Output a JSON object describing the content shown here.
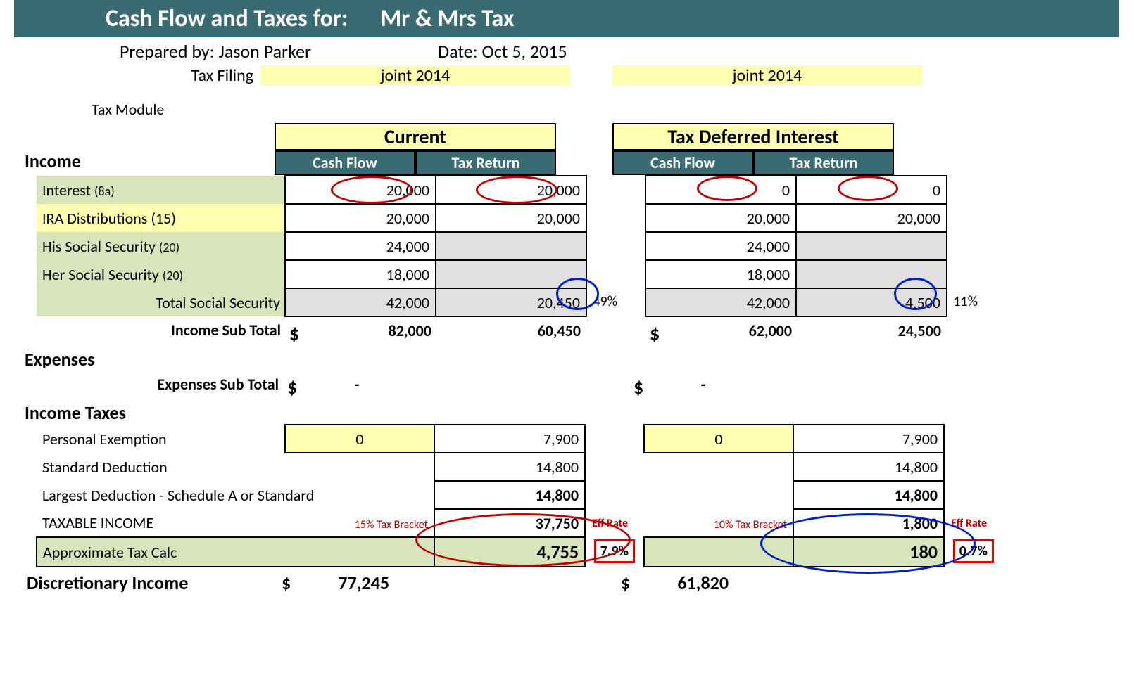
{
  "header": {
    "title_prefix": "Cash Flow and Taxes for:",
    "client_name": "Mr & Mrs Tax",
    "prepared_by_label": "Prepared by:",
    "prepared_by": "Jason Parker",
    "date_label": "Date:",
    "date": "Oct 5, 2015",
    "tax_filing_label": "Tax Filing",
    "filing_left": "joint 2014",
    "filing_right": "joint 2014",
    "module_label": "Tax Module"
  },
  "sections": {
    "income": "Income",
    "expenses": "Expenses",
    "income_taxes": "Income Taxes",
    "discretionary": "Discretionary Income"
  },
  "colheaders": {
    "current": "Current",
    "deferred": "Tax Deferred Interest",
    "cashflow": "Cash Flow",
    "taxreturn": "Tax Return"
  },
  "rows": {
    "interest": {
      "label": "Interest",
      "sub": "(8a)"
    },
    "ira": {
      "label": "IRA Distributions (15)"
    },
    "his_ss": {
      "label": "His Social Security",
      "sub": "(20)"
    },
    "her_ss": {
      "label": "Her Social Security",
      "sub": "(20)"
    },
    "total_ss": {
      "label": "Total Social Security"
    },
    "income_sub": {
      "label": "Income Sub Total"
    },
    "exp_sub": {
      "label": "Expenses Sub Total"
    },
    "pe": {
      "label": "Personal Exemption"
    },
    "sd": {
      "label": "Standard Deduction"
    },
    "largest": {
      "label": "Largest Deduction - Schedule A or Standard"
    },
    "taxable": {
      "label": "TAXABLE INCOME"
    },
    "approx": {
      "label": "Approximate Tax Calc"
    }
  },
  "current": {
    "interest_cf": "20,000",
    "interest_tr": "20,000",
    "ira_cf": "20,000",
    "ira_tr": "20,000",
    "his_ss_cf": "24,000",
    "her_ss_cf": "18,000",
    "total_ss_cf": "42,000",
    "total_ss_tr": "20,450",
    "total_ss_pct": "49%",
    "income_sub_cf": "82,000",
    "income_sub_tr": "60,450",
    "income_sub_sym": "$",
    "exp_sub_sym": "$",
    "exp_sub_val": "-",
    "pe_cf": "0",
    "pe_tr": "7,900",
    "sd_tr": "14,800",
    "largest_tr": "14,800",
    "bracket": "15% Tax Bracket",
    "taxable_tr": "37,750",
    "effrate_label": "Eff Rate",
    "approx_tr": "4,755",
    "eff_rate": "7.9%",
    "discretionary_sym": "$",
    "discretionary": "77,245"
  },
  "deferred": {
    "interest_cf": "0",
    "interest_tr": "0",
    "ira_cf": "20,000",
    "ira_tr": "20,000",
    "his_ss_cf": "24,000",
    "her_ss_cf": "18,000",
    "total_ss_cf": "42,000",
    "total_ss_tr": "4,500",
    "total_ss_pct": "11%",
    "income_sub_cf": "62,000",
    "income_sub_tr": "24,500",
    "income_sub_sym": "$",
    "exp_sub_sym": "$",
    "exp_sub_val": "-",
    "pe_cf": "0",
    "pe_tr": "7,900",
    "sd_tr": "14,800",
    "largest_tr": "14,800",
    "bracket": "10% Tax Bracket",
    "taxable_tr": "1,800",
    "effrate_label": "Eff Rate",
    "approx_tr": "180",
    "eff_rate": "0.7%",
    "discretionary_sym": "$",
    "discretionary": "61,820"
  }
}
